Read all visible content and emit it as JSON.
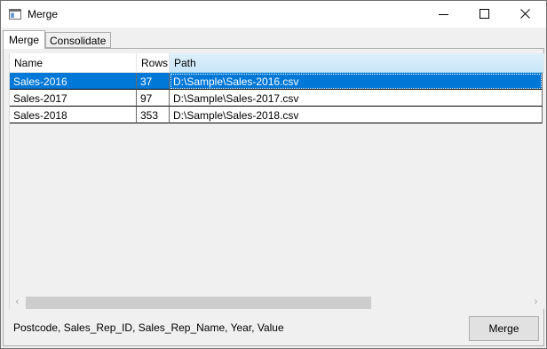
{
  "window": {
    "title": "Merge"
  },
  "tabs": [
    {
      "label": "Merge"
    },
    {
      "label": "Consolidate"
    }
  ],
  "grid": {
    "columns": [
      "Name",
      "Rows",
      "Path"
    ],
    "rows": [
      {
        "name": "Sales-2016",
        "rows": "37",
        "path": "D:\\Sample\\Sales-2016.csv"
      },
      {
        "name": "Sales-2017",
        "rows": "97",
        "path": "D:\\Sample\\Sales-2017.csv"
      },
      {
        "name": "Sales-2018",
        "rows": "353",
        "path": "D:\\Sample\\Sales-2018.csv"
      }
    ],
    "selected_row": 0
  },
  "footer": {
    "columns_text": "Postcode, Sales_Rep_ID, Sales_Rep_Name, Year, Value",
    "merge_button": "Merge"
  },
  "colors": {
    "selection": "#0078d7",
    "window_bg": "#f0f0f0"
  }
}
